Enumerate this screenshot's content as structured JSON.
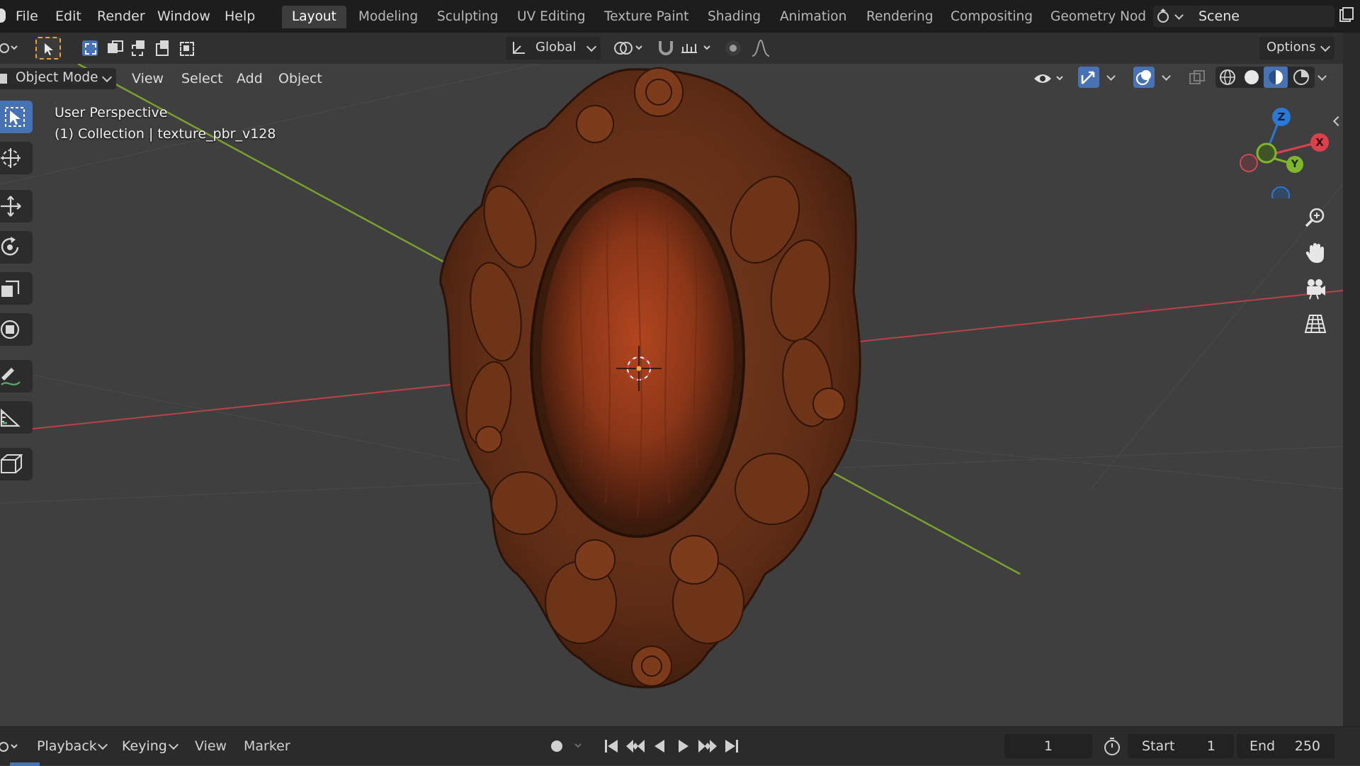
{
  "menu": {
    "file": "File",
    "edit": "Edit",
    "render": "Render",
    "window": "Window",
    "help": "Help"
  },
  "workspaces": [
    {
      "label": "Layout",
      "active": true
    },
    {
      "label": "Modeling"
    },
    {
      "label": "Sculpting"
    },
    {
      "label": "UV Editing"
    },
    {
      "label": "Texture Paint"
    },
    {
      "label": "Shading"
    },
    {
      "label": "Animation"
    },
    {
      "label": "Rendering"
    },
    {
      "label": "Compositing"
    },
    {
      "label": "Geometry Nod"
    }
  ],
  "scene": {
    "name": "Scene"
  },
  "toolbar": {
    "transform_orientation": "Global",
    "options_label": "Options"
  },
  "header": {
    "mode": "Object Mode",
    "view": "View",
    "select": "Select",
    "add": "Add",
    "object": "Object"
  },
  "viewport": {
    "perspective_label": "User Perspective",
    "collection_label": "(1) Collection | texture_pbr_v128"
  },
  "gizmo": {
    "z": "Z",
    "x": "X",
    "y": "Y"
  },
  "timeline": {
    "playback": "Playback",
    "keying": "Keying",
    "view": "View",
    "marker": "Marker",
    "current_frame": "1",
    "start_label": "Start",
    "start_value": "1",
    "end_label": "End",
    "end_value": "250"
  },
  "colors": {
    "accent": "#4772b3",
    "axis_x": "#d9414d",
    "axis_y": "#7fb72c",
    "axis_z": "#2b79d6",
    "wood": "#8a3618"
  }
}
